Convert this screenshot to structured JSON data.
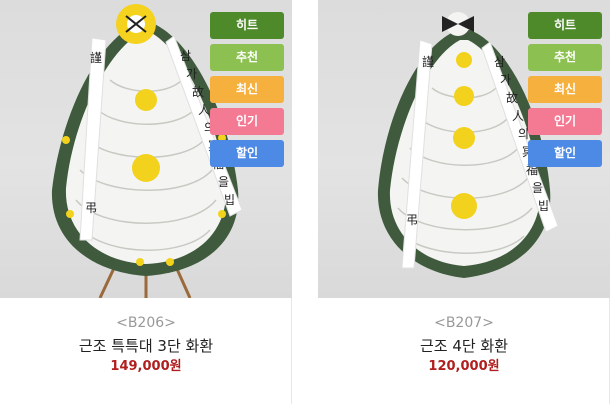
{
  "products": [
    {
      "code": "<B206>",
      "name": "근조 특특대 3단 화환",
      "price": "149,000원",
      "badges": [
        "히트",
        "추천",
        "최신",
        "인기",
        "할인"
      ],
      "ribbon_text": "삼가 故人의 冥福을 빕니다",
      "ribbon_side": "謹 弔"
    },
    {
      "code": "<B207>",
      "name": "근조 4단 화환",
      "price": "120,000원",
      "badges": [
        "히트",
        "추천",
        "최신",
        "인기",
        "할인"
      ],
      "ribbon_text": "삼가 故人의 冥福을 빕니다",
      "ribbon_side": "謹 弔"
    }
  ],
  "colors": {
    "hit": "#4e8a2a",
    "recommend": "#8cc152",
    "new": "#f6b03e",
    "popular": "#f47a94",
    "sale": "#4c8ae6",
    "price": "#b01e1e"
  }
}
